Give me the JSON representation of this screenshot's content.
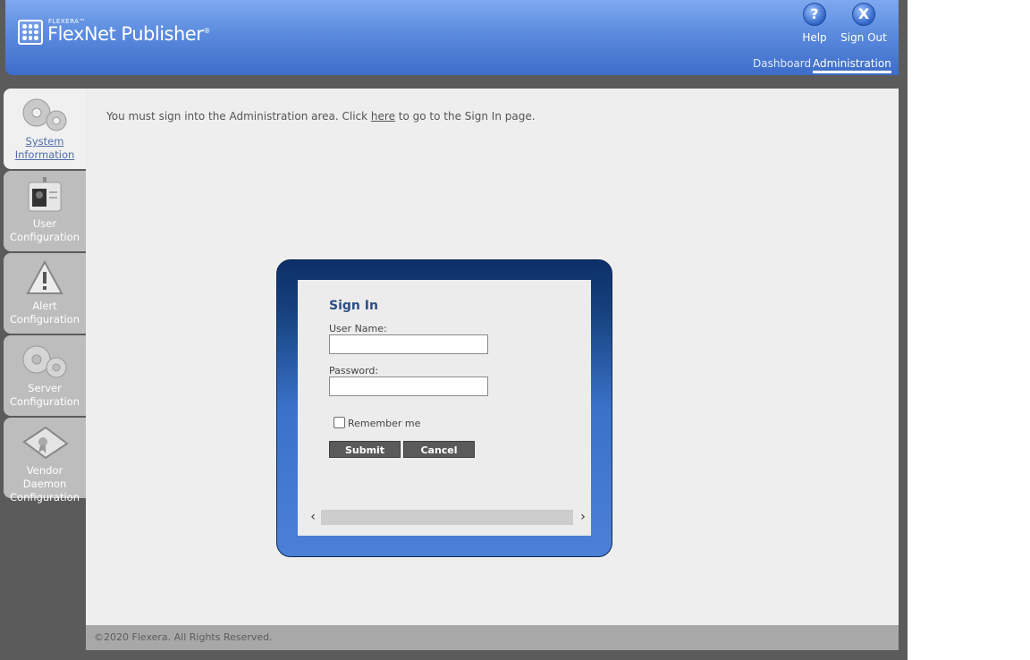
{
  "header": {
    "brand_small": "FLEXERA™",
    "brand_name": "FlexNet Publisher",
    "brand_mark": "®",
    "help_label": "Help",
    "signout_label": "Sign Out",
    "help_glyph": "?",
    "signout_glyph": "X",
    "nav_dashboard": "Dashboard",
    "nav_administration": "Administration"
  },
  "sidebar": {
    "items": [
      {
        "line1": "System",
        "line2": "Information",
        "icon": "gears-icon",
        "active": true
      },
      {
        "line1": "User",
        "line2": "Configuration",
        "icon": "id-badge-icon",
        "active": false
      },
      {
        "line1": "Alert",
        "line2": "Configuration",
        "icon": "warning-icon",
        "active": false
      },
      {
        "line1": "Server",
        "line2": "Configuration",
        "icon": "gears-icon",
        "active": false
      },
      {
        "line1": "Vendor Daemon",
        "line2": "Configuration",
        "icon": "certificate-icon",
        "active": false
      }
    ]
  },
  "main": {
    "message_pre": "You must sign into the Administration area. Click ",
    "message_link": "here",
    "message_post": " to go to the Sign In page."
  },
  "signin": {
    "title": "Sign In",
    "username_label": "User Name:",
    "username_value": "",
    "password_label": "Password:",
    "password_value": "",
    "remember_label": "Remember me",
    "remember_checked": false,
    "submit_label": "Submit",
    "cancel_label": "Cancel"
  },
  "footer": {
    "copyright": "©2020 Flexera. All Rights Reserved."
  }
}
